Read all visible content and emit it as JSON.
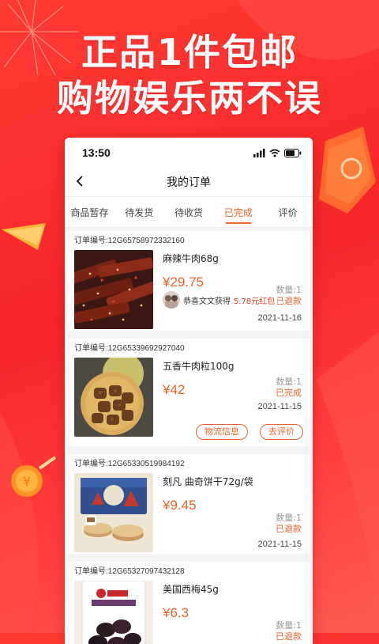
{
  "banner": {
    "line1": "正品1件包邮",
    "line2": "购物娱乐两不误"
  },
  "status_bar": {
    "time": "13:50"
  },
  "nav": {
    "title": "我的订单"
  },
  "tabs": [
    {
      "label": "商品暂存",
      "active": false
    },
    {
      "label": "待发货",
      "active": false
    },
    {
      "label": "待收货",
      "active": false
    },
    {
      "label": "已完成",
      "active": true
    },
    {
      "label": "评价",
      "active": false
    }
  ],
  "orders": [
    {
      "order_no": "订单编号:12G65758972332160",
      "name": "麻辣牛肉68g",
      "price": "¥29.75",
      "qty": "数量:1",
      "status": "已退款",
      "date": "2021-11-16",
      "coupon_text": "恭喜文文获得",
      "coupon_amount": "5.78元红包"
    },
    {
      "order_no": "订单编号:12G65339692927040",
      "name": "五香牛肉粒100g",
      "price": "¥42",
      "qty": "数量:1",
      "status": "已完成",
      "date": "2021-11-15",
      "buttons": [
        "物流信息",
        "去评价"
      ]
    },
    {
      "order_no": "订单编号:12G65330519984192",
      "name": "刻凡 曲奇饼干72g/袋",
      "price": "¥9.45",
      "qty": "数量:1",
      "status": "已退款",
      "date": "2021-11-15"
    },
    {
      "order_no": "订单编号:12G65327097432128",
      "name": "美国西梅45g",
      "price": "¥6.3",
      "qty": "数量:1",
      "status": "已退款"
    }
  ],
  "colors": {
    "accent": "#e8632a",
    "background": "#f7262b"
  }
}
